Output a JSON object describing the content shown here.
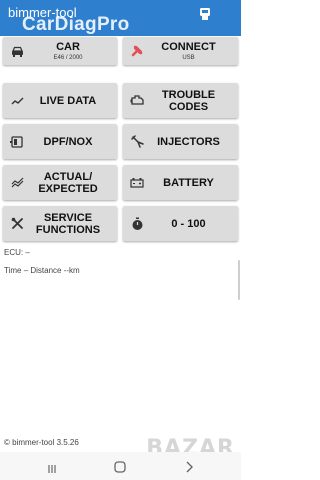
{
  "app": {
    "title": "bimmer-tool",
    "watermark": "CarDiagPro"
  },
  "tiles": {
    "car": {
      "label": "CAR",
      "sub": "E46 / 2000"
    },
    "connect": {
      "label": "CONNECT",
      "sub": "USB"
    },
    "live_data": {
      "label": "LIVE DATA"
    },
    "trouble_codes": {
      "label": "TROUBLE CODES"
    },
    "dpf_nox": {
      "label": "DPF/NOX"
    },
    "injectors": {
      "label": "INJECTORS"
    },
    "actual_expected": {
      "label_line1": "ACTUAL/",
      "label_line2": "EXPECTED"
    },
    "battery": {
      "label": "BATTERY"
    },
    "service_functions": {
      "label_line1": "SERVICE",
      "label_line2": "FUNCTIONS"
    },
    "zero_hundred": {
      "label": "0 - 100"
    }
  },
  "info": {
    "ecu": "ECU: –",
    "time_distance": "Time –   Distance --km"
  },
  "footer": {
    "copyright": "© bimmer-tool 3.5.26",
    "watermark": "BAZAR"
  },
  "colors": {
    "appbar": "#2f7fcf",
    "tile": "#dcdcdc",
    "connect_icon": "#e0505a"
  }
}
